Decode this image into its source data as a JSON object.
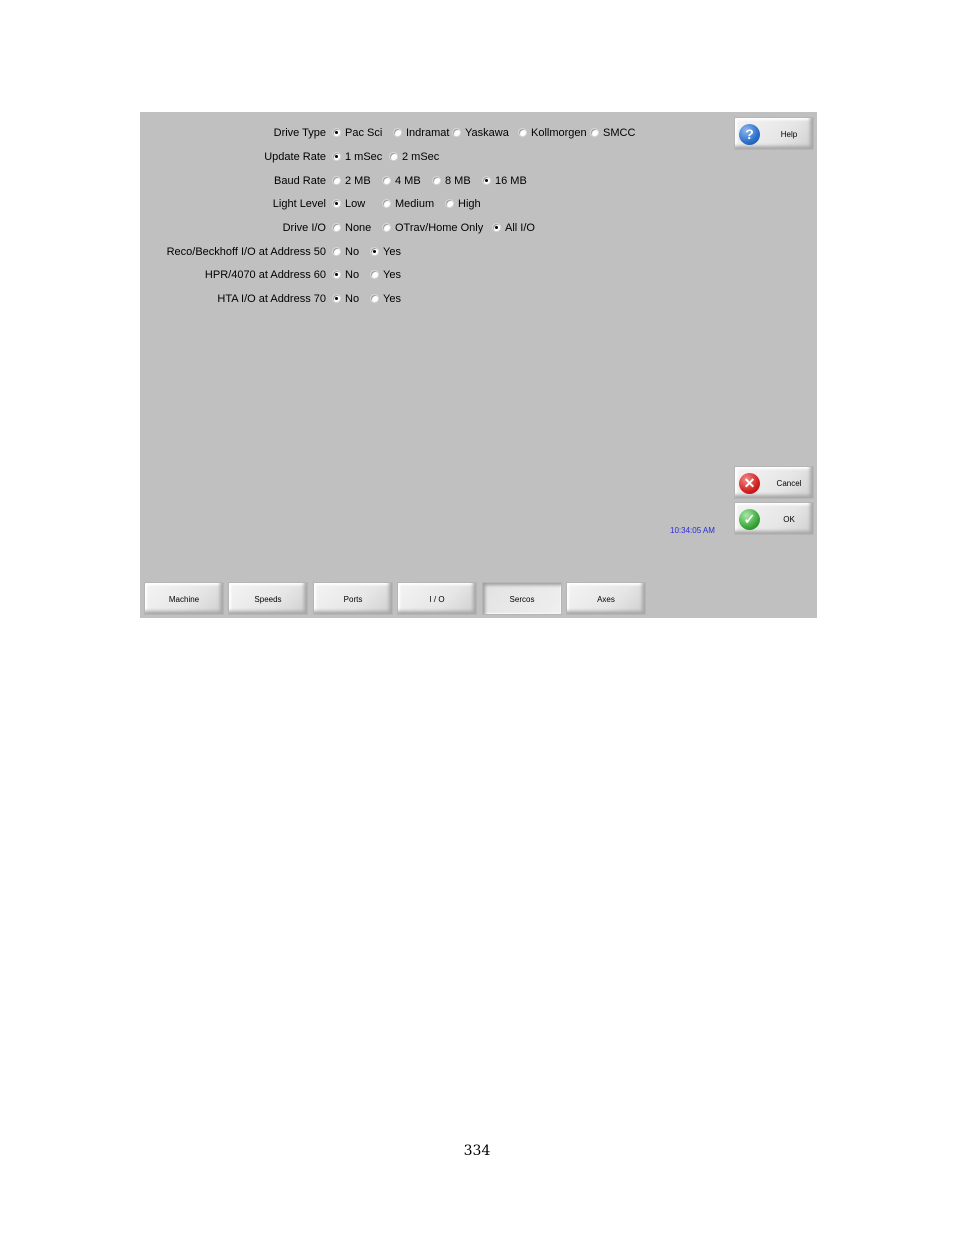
{
  "form": {
    "rows": [
      {
        "label": "Drive Type",
        "options": [
          "Pac Sci",
          "Indramat",
          "Yaskawa",
          "Kollmorgen",
          "SMCC"
        ],
        "selected": "Pac Sci"
      },
      {
        "label": "Update Rate",
        "options": [
          "1 mSec",
          "2 mSec"
        ],
        "selected": "1 mSec"
      },
      {
        "label": "Baud Rate",
        "options": [
          "2 MB",
          "4 MB",
          "8 MB",
          "16 MB"
        ],
        "selected": "16 MB"
      },
      {
        "label": "Light Level",
        "options": [
          "Low",
          "Medium",
          "High"
        ],
        "selected": "Low"
      },
      {
        "label": "Drive I/O",
        "options": [
          "None",
          "OTrav/Home Only",
          "All I/O"
        ],
        "selected": "All I/O"
      },
      {
        "label": "Reco/Beckhoff I/O at Address 50",
        "options": [
          "No",
          "Yes"
        ],
        "selected": "Yes"
      },
      {
        "label": "HPR/4070 at Address 60",
        "options": [
          "No",
          "Yes"
        ],
        "selected": "No"
      },
      {
        "label": "HTA I/O at Address 70",
        "options": [
          "No",
          "Yes"
        ],
        "selected": "No"
      }
    ]
  },
  "buttons": {
    "help": {
      "label": "Help",
      "icon": "question-icon",
      "color": "#2b6fc9"
    },
    "cancel": {
      "label": "Cancel",
      "icon": "x-icon",
      "color": "#d42020"
    },
    "ok": {
      "label": "OK",
      "icon": "check-icon",
      "color": "#3aa83a"
    }
  },
  "clock": "10:34:05 AM",
  "tabs": [
    {
      "label": "Machine",
      "selected": false
    },
    {
      "label": "Speeds",
      "selected": false
    },
    {
      "label": "Ports",
      "selected": false
    },
    {
      "label": "I / O",
      "selected": false
    },
    {
      "label": "Sercos",
      "selected": true
    },
    {
      "label": "Axes",
      "selected": false
    }
  ],
  "page_number": "334"
}
